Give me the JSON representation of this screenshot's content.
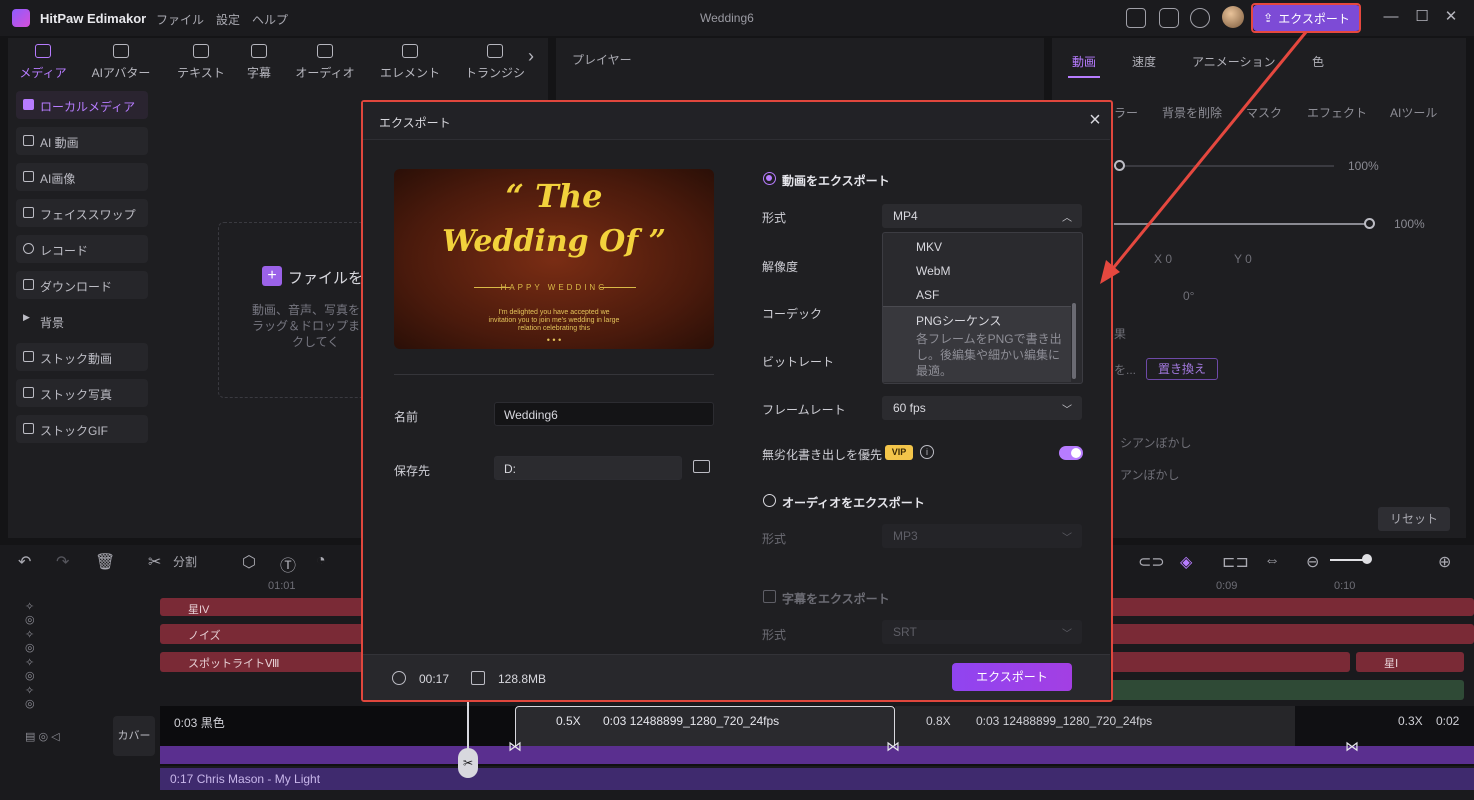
{
  "titlebar": {
    "app_name": "HitPaw Edimakor",
    "menu": [
      "ファイル",
      "設定",
      "ヘルプ"
    ],
    "window_title": "Wedding6",
    "export_label": "エクスポート"
  },
  "media_toolbar": {
    "tabs": [
      "メディア",
      "AIアバター",
      "テキスト",
      "字幕",
      "オーディオ",
      "エレメント",
      "トランジシ"
    ]
  },
  "sidebar": {
    "items": [
      {
        "label": "ローカルメディア"
      },
      {
        "label": "AI 動画"
      },
      {
        "label": "AI画像"
      },
      {
        "label": "フェイススワップ"
      },
      {
        "label": "レコード"
      },
      {
        "label": "ダウンロード"
      },
      {
        "label": "背景"
      },
      {
        "label": "ストック動画"
      },
      {
        "label": "ストック写真"
      },
      {
        "label": "ストックGIF"
      }
    ]
  },
  "media_area": {
    "add_file": "ファイルを",
    "hint_lines": [
      "動画、音声、写真を",
      "ラッグ＆ドロップま",
      "クしてく"
    ]
  },
  "player": {
    "label": "プレイヤー"
  },
  "right_panel": {
    "tabs": [
      "動画",
      "速度",
      "アニメーション",
      "色"
    ],
    "subtabs": [
      "ラー",
      "背景を削除",
      "マスク",
      "エフェクト",
      "AIツール"
    ],
    "values": [
      "100%",
      "100%",
      "X 0",
      "Y 0",
      "0°"
    ],
    "replace_label": "置き換え",
    "blur_label_1": "シアンぼかし",
    "blur_label_2": "アンぼかし",
    "reset_label": "リセット",
    "partial_1": "果",
    "partial_2": "を..."
  },
  "timeline": {
    "split_label": "分割",
    "ruler": [
      "01:01",
      "0:09",
      "0:10"
    ],
    "tracks": [
      {
        "label": "星IV"
      },
      {
        "label": "ノイズ"
      },
      {
        "label": "スポットライトⅧ"
      }
    ],
    "right_track_label": "星Ⅰ",
    "cover_label": "カバー",
    "video_clip": "0:03 黒色",
    "clip_a": "0:03 12488899_1280_720_24fps",
    "clip_b": "0:03 12488899_1280_720_24fps",
    "clip_c": "0:02",
    "speed_a": "0.5X",
    "speed_b": "0.8X",
    "speed_c": "0.3X",
    "audio_clip": "0:17 Chris Mason - My Light"
  },
  "export_dialog": {
    "title": "エクスポート",
    "preview": {
      "title_line1": "“ The",
      "title_line2": "Wedding Of ”",
      "subtitle": "HAPPY WEDDING",
      "small_text": "I'm delighted you have accepted we invitation you to join me's wedding in large relation celebrating this",
      "dots": "• • •"
    },
    "name_label": "名前",
    "name_value": "Wedding6",
    "save_label": "保存先",
    "save_value": "D:",
    "video_export_label": "動画をエクスポート",
    "format_label": "形式",
    "format_value": "MP4",
    "resolution_label": "解像度",
    "codec_label": "コーデック",
    "bitrate_label": "ビットレート",
    "framerate_label": "フレームレート",
    "framerate_value": "60  fps",
    "lossless_label": "無劣化書き出しを優先",
    "vip_badge": "VIP",
    "lossless_on": true,
    "dropdown_options": [
      "MKV",
      "WebM",
      "ASF",
      "PNGシーケンス"
    ],
    "dropdown_desc": "各フレームをPNGで書き出し。後編集や細かい編集に最適。",
    "audio_export_label": "オーディオをエクスポート",
    "audio_format_label": "形式",
    "audio_format_value": "MP3",
    "subtitle_export_label": "字幕をエクスポート",
    "subtitle_format_label": "形式",
    "subtitle_format_value": "SRT",
    "duration": "00:17",
    "file_size": "128.8MB",
    "export_button": "エクスポート"
  },
  "colors": {
    "accent": "#b77cff",
    "highlight_border": "#e0473d",
    "export_button": "#9044f0"
  }
}
